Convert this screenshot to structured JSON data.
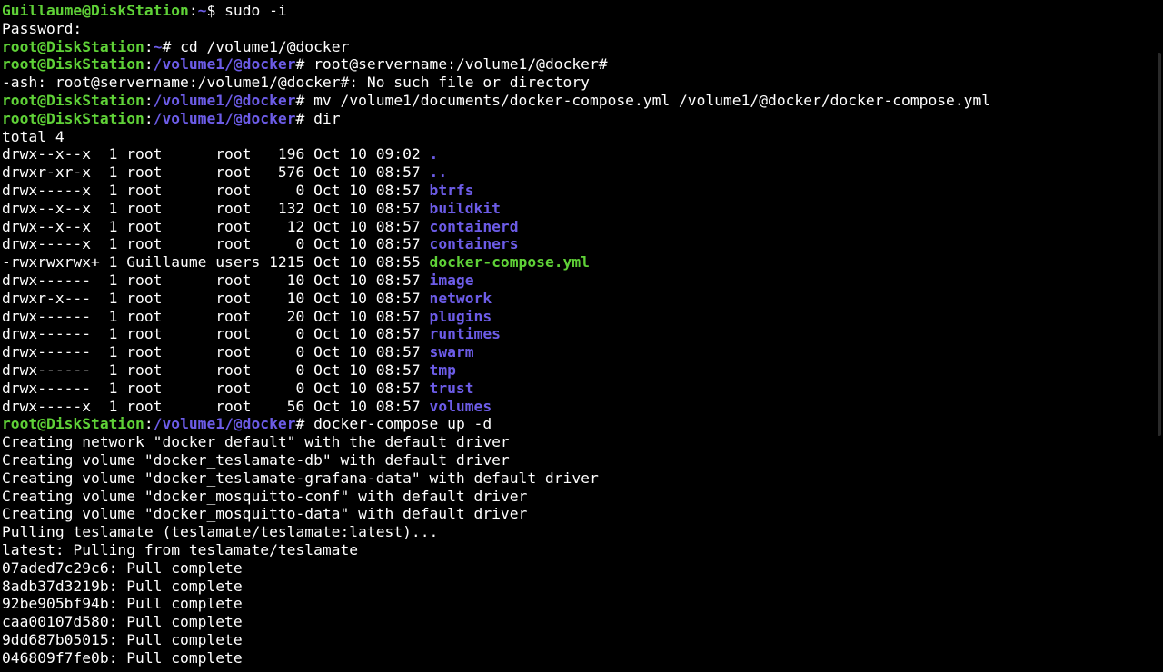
{
  "terminal": {
    "lines": [
      {
        "type": "prompt",
        "user": "Guillaume@DiskStation",
        "sep": ":",
        "cwd": "~",
        "sym": "$ ",
        "cmd": "sudo -i"
      },
      {
        "type": "text",
        "text": "Password:"
      },
      {
        "type": "prompt",
        "user": "root@DiskStation",
        "sep": ":",
        "cwd": "~",
        "sym": "# ",
        "cmd": "cd /volume1/@docker"
      },
      {
        "type": "prompt",
        "user": "root@DiskStation",
        "sep": ":",
        "cwd": "/volume1/@docker",
        "sym": "# ",
        "cmd": "root@servername:/volume1/@docker#"
      },
      {
        "type": "text",
        "text": "-ash: root@servername:/volume1/@docker#: No such file or directory"
      },
      {
        "type": "prompt",
        "user": "root@DiskStation",
        "sep": ":",
        "cwd": "/volume1/@docker",
        "sym": "# ",
        "cmd": "mv /volume1/documents/docker-compose.yml /volume1/@docker/docker-compose.yml"
      },
      {
        "type": "prompt",
        "user": "root@DiskStation",
        "sep": ":",
        "cwd": "/volume1/@docker",
        "sym": "# ",
        "cmd": "dir"
      },
      {
        "type": "text",
        "text": "total 4"
      },
      {
        "type": "ls",
        "prefix": "drwx--x--x  1 root      root   196 Oct 10 09:02 ",
        "name": ".",
        "kind": "dir"
      },
      {
        "type": "ls",
        "prefix": "drwxr-xr-x  1 root      root   576 Oct 10 08:57 ",
        "name": "..",
        "kind": "dir"
      },
      {
        "type": "ls",
        "prefix": "drwx-----x  1 root      root     0 Oct 10 08:57 ",
        "name": "btrfs",
        "kind": "dir"
      },
      {
        "type": "ls",
        "prefix": "drwx--x--x  1 root      root   132 Oct 10 08:57 ",
        "name": "buildkit",
        "kind": "dir"
      },
      {
        "type": "ls",
        "prefix": "drwx--x--x  1 root      root    12 Oct 10 08:57 ",
        "name": "containerd",
        "kind": "dir"
      },
      {
        "type": "ls",
        "prefix": "drwx-----x  1 root      root     0 Oct 10 08:57 ",
        "name": "containers",
        "kind": "dir"
      },
      {
        "type": "ls",
        "prefix": "-rwxrwxrwx+ 1 Guillaume users 1215 Oct 10 08:55 ",
        "name": "docker-compose.yml",
        "kind": "exec"
      },
      {
        "type": "ls",
        "prefix": "drwx------  1 root      root    10 Oct 10 08:57 ",
        "name": "image",
        "kind": "dir"
      },
      {
        "type": "ls",
        "prefix": "drwxr-x---  1 root      root    10 Oct 10 08:57 ",
        "name": "network",
        "kind": "dir"
      },
      {
        "type": "ls",
        "prefix": "drwx------  1 root      root    20 Oct 10 08:57 ",
        "name": "plugins",
        "kind": "dir"
      },
      {
        "type": "ls",
        "prefix": "drwx------  1 root      root     0 Oct 10 08:57 ",
        "name": "runtimes",
        "kind": "dir"
      },
      {
        "type": "ls",
        "prefix": "drwx------  1 root      root     0 Oct 10 08:57 ",
        "name": "swarm",
        "kind": "dir"
      },
      {
        "type": "ls",
        "prefix": "drwx------  1 root      root     0 Oct 10 08:57 ",
        "name": "tmp",
        "kind": "dir"
      },
      {
        "type": "ls",
        "prefix": "drwx------  1 root      root     0 Oct 10 08:57 ",
        "name": "trust",
        "kind": "dir"
      },
      {
        "type": "ls",
        "prefix": "drwx-----x  1 root      root    56 Oct 10 08:57 ",
        "name": "volumes",
        "kind": "dir"
      },
      {
        "type": "prompt",
        "user": "root@DiskStation",
        "sep": ":",
        "cwd": "/volume1/@docker",
        "sym": "# ",
        "cmd": "docker-compose up -d"
      },
      {
        "type": "text",
        "text": "Creating network \"docker_default\" with the default driver"
      },
      {
        "type": "text",
        "text": "Creating volume \"docker_teslamate-db\" with default driver"
      },
      {
        "type": "text",
        "text": "Creating volume \"docker_teslamate-grafana-data\" with default driver"
      },
      {
        "type": "text",
        "text": "Creating volume \"docker_mosquitto-conf\" with default driver"
      },
      {
        "type": "text",
        "text": "Creating volume \"docker_mosquitto-data\" with default driver"
      },
      {
        "type": "text",
        "text": "Pulling teslamate (teslamate/teslamate:latest)..."
      },
      {
        "type": "text",
        "text": "latest: Pulling from teslamate/teslamate"
      },
      {
        "type": "text",
        "text": "07aded7c29c6: Pull complete"
      },
      {
        "type": "text",
        "text": "8adb37d3219b: Pull complete"
      },
      {
        "type": "text",
        "text": "92be905bf94b: Pull complete"
      },
      {
        "type": "text",
        "text": "caa00107d580: Pull complete"
      },
      {
        "type": "text",
        "text": "9dd687b05015: Pull complete"
      },
      {
        "type": "text",
        "text": "046809f7fe0b: Pull complete"
      }
    ]
  },
  "colors": {
    "background": "#000000",
    "text": "#ffffff",
    "prompt_user": "#5fd137",
    "prompt_path": "#6c5ce7",
    "ls_directory": "#6c5ce7",
    "ls_executable": "#5fd137"
  },
  "scrollbar": {
    "position_fraction": 0.1,
    "visible_fraction": 0.57
  }
}
